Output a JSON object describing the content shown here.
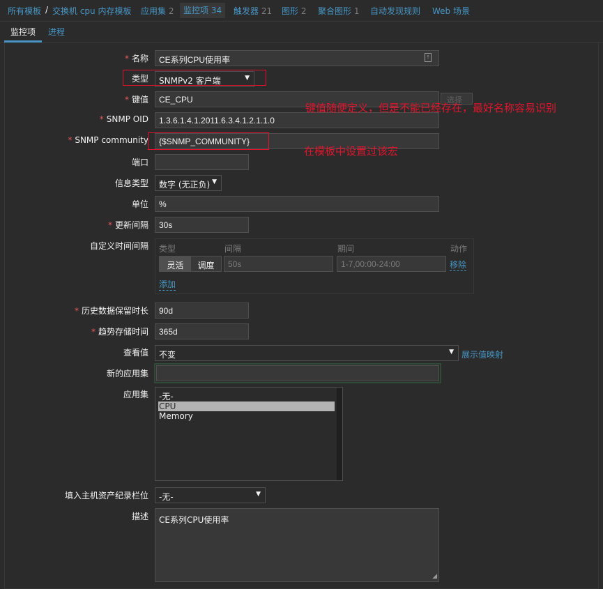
{
  "breadcrumb": {
    "all_templates": "所有模板",
    "separator": "/",
    "template": "交换机 cpu 内存模板",
    "applications": "应用集",
    "applications_count": "2",
    "items": "监控项",
    "items_count": "34",
    "triggers": "触发器",
    "triggers_count": "21",
    "graphs": "图形",
    "graphs_count": "2",
    "screens": "聚合图形",
    "screens_count": "1",
    "discovery": "自动发现规则",
    "web": "Web 场景"
  },
  "tabs": {
    "item": "监控项",
    "preprocessing": "进程"
  },
  "form": {
    "name_label": "名称",
    "name_value": "CE系列CPU使用率",
    "type_label": "类型",
    "type_value": "SNMPv2 客户端",
    "key_label": "键值",
    "key_value": "CE_CPU",
    "key_select_button": "选择",
    "oid_label": "SNMP OID",
    "oid_value": "1.3.6.1.4.1.2011.6.3.4.1.2.1.1.0",
    "community_label": "SNMP community",
    "community_value": "{$SNMP_COMMUNITY}",
    "port_label": "端口",
    "port_value": "",
    "info_type_label": "信息类型",
    "info_type_value": "数字 (无正负)",
    "units_label": "单位",
    "units_value": "%",
    "update_label": "更新间隔",
    "update_value": "30s",
    "custom_intervals_label": "自定义时间间隔",
    "intervals": {
      "col_type": "类型",
      "col_interval": "间隔",
      "col_period": "期间",
      "col_action": "动作",
      "flexible": "灵活",
      "scheduling": "调度",
      "interval_placeholder": "50s",
      "period_placeholder": "1-7,00:00-24:00",
      "remove": "移除",
      "add": "添加"
    },
    "history_label": "历史数据保留时长",
    "history_value": "90d",
    "trends_label": "趋势存储时间",
    "trends_value": "365d",
    "valuemap_label": "查看值",
    "valuemap_value": "不变",
    "valuemap_link": "展示值映射",
    "new_app_label": "新的应用集",
    "new_app_value": "",
    "apps_label": "应用集",
    "apps_options": [
      "-无-",
      "CPU",
      "Memory"
    ],
    "inventory_label": "填入主机资产纪录栏位",
    "inventory_value": "-无-",
    "desc_label": "描述",
    "desc_value": "CE系列CPU使用率"
  },
  "annotations": {
    "key_note": "键值随便定义，但是不能已经存在，最好名称容易识别",
    "macro_note": "在模板中设置过该宏"
  }
}
